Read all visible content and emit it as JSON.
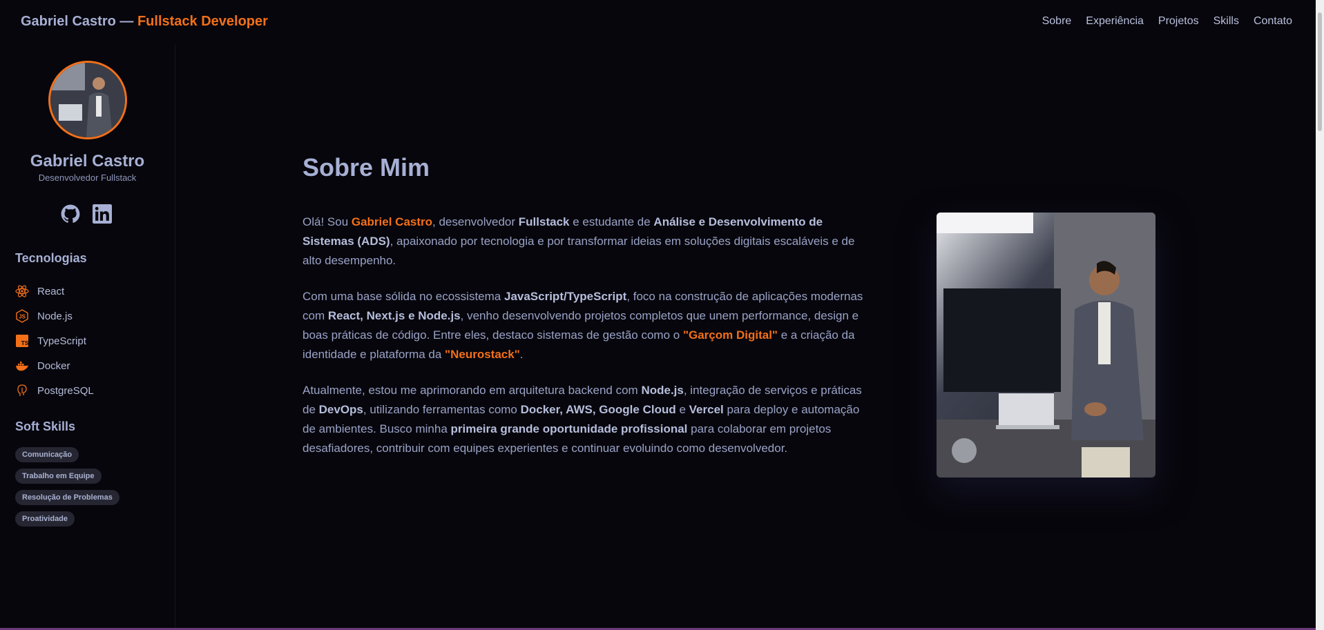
{
  "header": {
    "brand_name": "Gabriel Castro —",
    "brand_role": "Fullstack Developer",
    "nav": [
      "Sobre",
      "Experiência",
      "Projetos",
      "Skills",
      "Contato"
    ]
  },
  "sidebar": {
    "name": "Gabriel Castro",
    "role": "Desenvolvedor Fullstack",
    "social_icons": [
      "github-icon",
      "linkedin-icon"
    ],
    "tech_heading": "Tecnologias",
    "technologies": [
      {
        "label": "React",
        "icon": "react-icon"
      },
      {
        "label": "Node.js",
        "icon": "nodejs-icon"
      },
      {
        "label": "TypeScript",
        "icon": "typescript-icon"
      },
      {
        "label": "Docker",
        "icon": "docker-icon"
      },
      {
        "label": "PostgreSQL",
        "icon": "postgresql-icon"
      }
    ],
    "soft_heading": "Soft Skills",
    "soft_skills": [
      "Comunicação",
      "Trabalho em Equipe",
      "Resolução de Problemas",
      "Proatividade"
    ]
  },
  "main": {
    "title": "Sobre Mim",
    "p1": [
      {
        "t": "Olá! Sou "
      },
      {
        "t": "Gabriel Castro",
        "s": "hl"
      },
      {
        "t": ", desenvolvedor "
      },
      {
        "t": "Fullstack",
        "s": "b"
      },
      {
        "t": " e estudante de "
      },
      {
        "t": "Análise e Desenvolvimento de Sistemas (ADS)",
        "s": "b"
      },
      {
        "t": ", apaixonado por tecnologia e por transformar ideias em soluções digitais escaláveis e de alto desempenho."
      }
    ],
    "p2": [
      {
        "t": "Com uma base sólida no ecossistema "
      },
      {
        "t": "JavaScript/TypeScript",
        "s": "b"
      },
      {
        "t": ", foco na construção de aplicações modernas com "
      },
      {
        "t": "React, Next.js e Node.js",
        "s": "b"
      },
      {
        "t": ", venho desenvolvendo projetos completos que unem performance, design e boas práticas de código. Entre eles, destaco sistemas de gestão como o "
      },
      {
        "t": "\"Garçom Digital\"",
        "s": "hl"
      },
      {
        "t": " e a criação da identidade e plataforma da "
      },
      {
        "t": "\"Neurostack\"",
        "s": "hl"
      },
      {
        "t": "."
      }
    ],
    "p3": [
      {
        "t": "Atualmente, estou me aprimorando em arquitetura backend com "
      },
      {
        "t": "Node.js",
        "s": "b"
      },
      {
        "t": ", integração de serviços e práticas de "
      },
      {
        "t": "DevOps",
        "s": "b"
      },
      {
        "t": ", utilizando ferramentas como "
      },
      {
        "t": "Docker, AWS, Google Cloud",
        "s": "b"
      },
      {
        "t": " e "
      },
      {
        "t": "Vercel",
        "s": "b"
      },
      {
        "t": " para deploy e automação de ambientes. Busco minha "
      },
      {
        "t": "primeira grande oportunidade profissional",
        "s": "b"
      },
      {
        "t": " para colaborar em projetos desafiadores, contribuir com equipes experientes e continuar evoluindo como desenvolvedor."
      }
    ]
  },
  "colors": {
    "accent": "#f37019",
    "background": "#07060c",
    "text": "#a7b0d4"
  }
}
